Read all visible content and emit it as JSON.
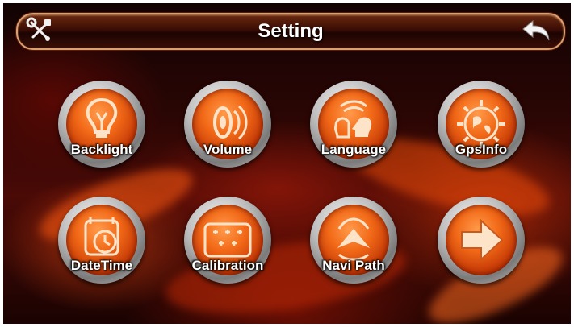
{
  "header": {
    "title": "Setting",
    "tools_icon": "tools-icon",
    "back_icon": "back-arrow-icon"
  },
  "items": [
    {
      "label": "Backlight",
      "icon": "lightbulb-icon"
    },
    {
      "label": "Volume",
      "icon": "speaker-icon"
    },
    {
      "label": "Language",
      "icon": "speaking-heads-icon"
    },
    {
      "label": "GpsInfo",
      "icon": "globe-gear-icon"
    },
    {
      "label": "DateTime",
      "icon": "calendar-clock-icon"
    },
    {
      "label": "Calibration",
      "icon": "crosshair-grid-icon"
    },
    {
      "label": "Navi Path",
      "icon": "navigation-arrow-icon"
    },
    {
      "label": "",
      "icon": "next-page-arrow-icon"
    }
  ],
  "colors": {
    "accent": "#f26a18",
    "ring": "#bdbdbd",
    "title_text": "#ffffff"
  }
}
